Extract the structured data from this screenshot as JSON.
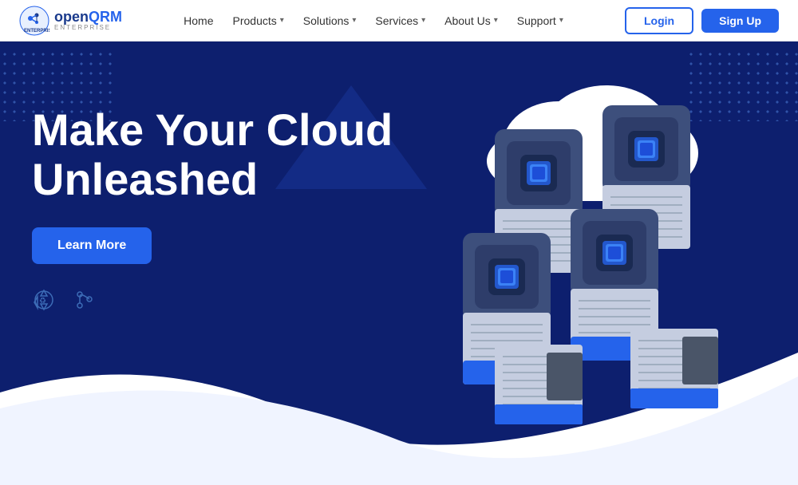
{
  "navbar": {
    "logo_brand": "openQRM",
    "logo_open": "open",
    "logo_qrm": "QRM",
    "logo_sub": "ENTERPRISE",
    "nav_items": [
      {
        "label": "Home",
        "has_dropdown": false
      },
      {
        "label": "Products",
        "has_dropdown": true
      },
      {
        "label": "Solutions",
        "has_dropdown": true
      },
      {
        "label": "Services",
        "has_dropdown": true
      },
      {
        "label": "About Us",
        "has_dropdown": true
      },
      {
        "label": "Support",
        "has_dropdown": true
      }
    ],
    "login_label": "Login",
    "signup_label": "Sign Up"
  },
  "hero": {
    "title_line1": "Make Your Cloud",
    "title_line2": "Unleashed",
    "learn_more_label": "Learn More",
    "accent_color": "#2563eb",
    "bg_color": "#0d1f6e"
  }
}
